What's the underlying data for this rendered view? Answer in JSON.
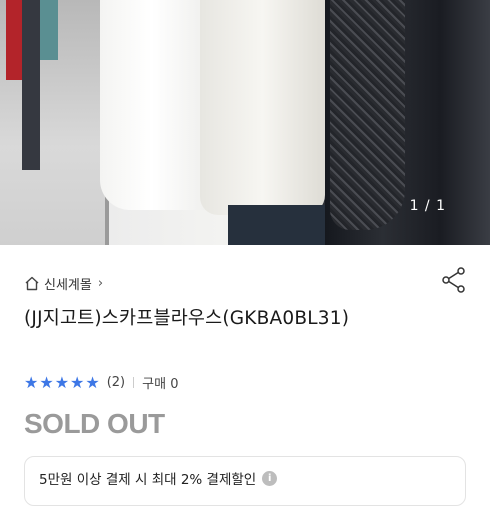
{
  "gallery": {
    "counter": "1 / 1"
  },
  "breadcrumb": {
    "home_icon": "home-icon",
    "label": "신세계몰",
    "chevron": "›"
  },
  "product": {
    "title": "(JJ지고트)스카프블라우스(GKBA0BL31)",
    "rating_stars": 5,
    "review_count": "(2)",
    "purchase_count": "구매 0",
    "status": "SOLD OUT"
  },
  "promo": {
    "text": "5만원 이상 결제 시 최대 2% 결제할인",
    "info_icon": "info-icon"
  },
  "colors": {
    "accent_star": "#3d77e6",
    "soldout": "#9a9a9a"
  }
}
